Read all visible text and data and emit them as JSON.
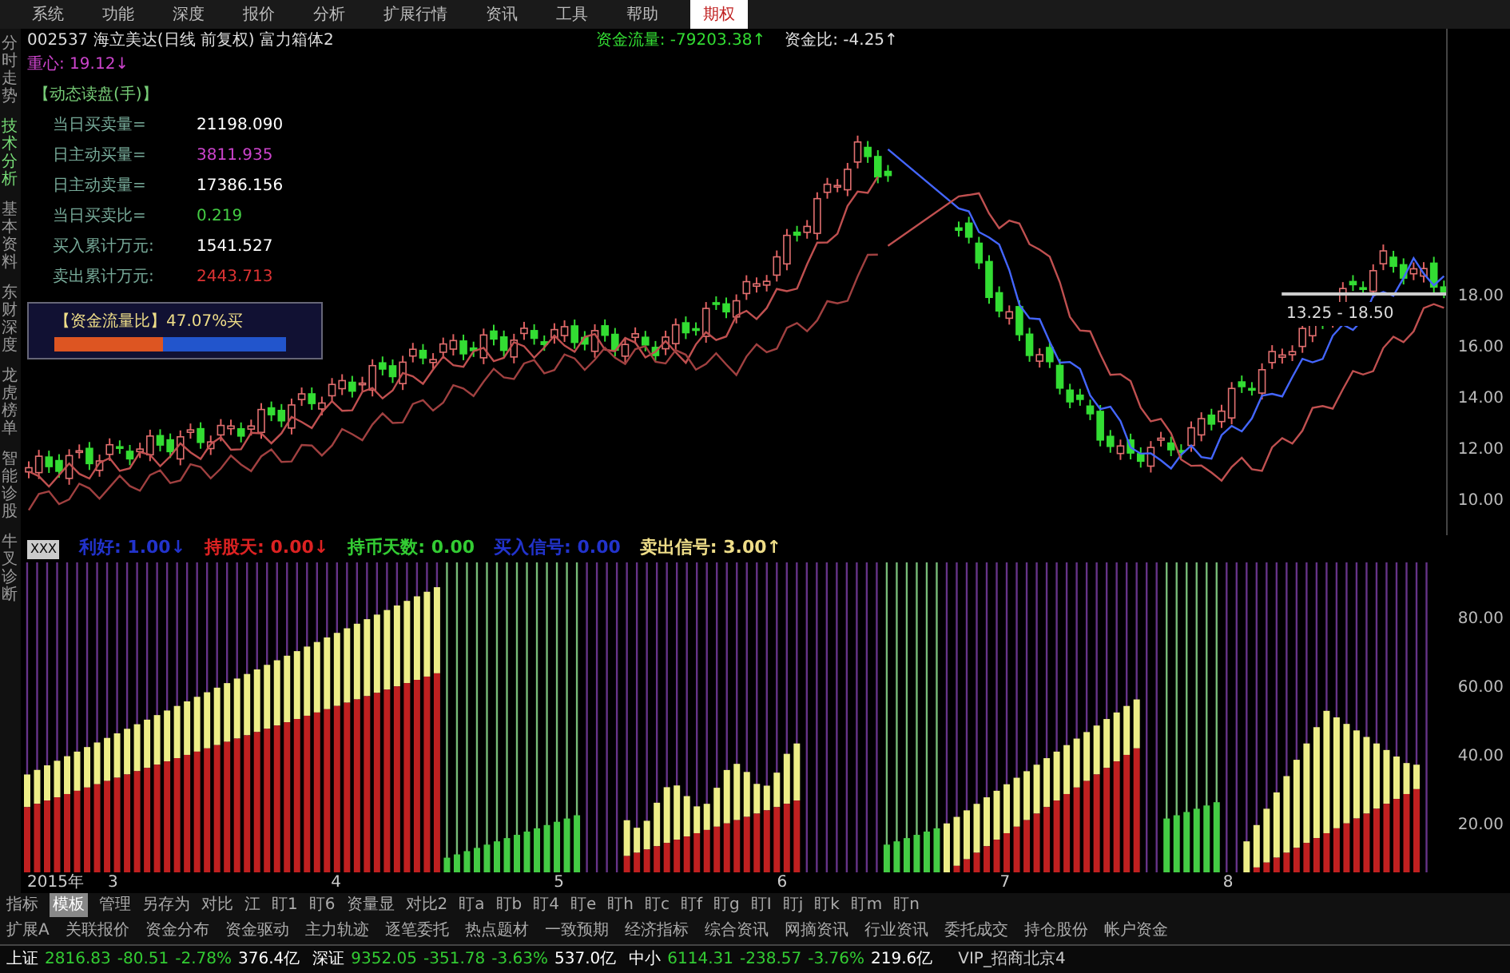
{
  "menu": [
    {
      "label": "系统",
      "selected": false
    },
    {
      "label": "功能",
      "selected": false
    },
    {
      "label": "深度",
      "selected": false
    },
    {
      "label": "报价",
      "selected": false
    },
    {
      "label": "分析",
      "selected": false
    },
    {
      "label": "扩展行情",
      "selected": false
    },
    {
      "label": "资讯",
      "selected": false
    },
    {
      "label": "工具",
      "selected": false
    },
    {
      "label": "帮助",
      "selected": false
    },
    {
      "label": "期权",
      "selected": true
    }
  ],
  "sidebar": [
    {
      "label": "分时走势",
      "selected": false
    },
    {
      "label": "技术分析",
      "selected": true
    },
    {
      "label": "基本资料",
      "selected": false
    },
    {
      "label": "东财深度",
      "selected": false
    },
    {
      "label": "龙虎榜单",
      "selected": false
    },
    {
      "label": "智能诊股",
      "selected": false
    },
    {
      "label": "牛叉诊断",
      "selected": false
    }
  ],
  "header": {
    "title": "002537 海立美达(日线 前复权) 富力箱体2",
    "readings": [
      {
        "text": "资金流量: -79203.38↑",
        "color": "#33dd33"
      },
      {
        "text": "资金比: -4.25↑",
        "color": "#e0e0e0"
      }
    ],
    "center": "重心: 19.12↓"
  },
  "info_panel": {
    "title": "【动态读盘(手)】",
    "rows": [
      {
        "label": "当日买卖量=",
        "value": "21198.090",
        "color": "#ffffff"
      },
      {
        "label": "日主动买量=",
        "value": "3811.935",
        "color": "#cc44cc"
      },
      {
        "label": "日主动卖量=",
        "value": "17386.156",
        "color": "#ffffff"
      },
      {
        "label": "当日买卖比=",
        "value": "0.219",
        "color": "#44cc44"
      },
      {
        "label": "买入累计万元:",
        "value": "1541.527",
        "color": "#ffffff"
      },
      {
        "label": "卖出累计万元:",
        "value": "2443.713",
        "color": "#dd3333"
      }
    ]
  },
  "fund_ratio": {
    "text": "【资金流量比】47.07%买",
    "level": 0.47
  },
  "price_axis": [
    "18.00",
    "16.00",
    "14.00",
    "12.00",
    "10.00"
  ],
  "range_label": "13.25 - 18.50",
  "indicator": {
    "name": "XXX",
    "items": [
      {
        "text": "利好: 1.00↓",
        "color": "#2233cc"
      },
      {
        "text": "持股天: 0.00↓",
        "color": "#dd2222"
      },
      {
        "text": "持币天数: 0.00",
        "color": "#33cc33"
      },
      {
        "text": "买入信号: 0.00",
        "color": "#2233cc"
      },
      {
        "text": "卖出信号: 3.00↑",
        "color": "#eedd88"
      }
    ]
  },
  "lower_axis": [
    "80.00",
    "60.00",
    "40.00",
    "20.00"
  ],
  "dates": [
    "2015年",
    "3",
    "4",
    "5",
    "6",
    "7",
    "8"
  ],
  "tabs": [
    {
      "label": "指标",
      "selected": false
    },
    {
      "label": "模板",
      "selected": true
    },
    {
      "label": "管理",
      "selected": false
    },
    {
      "label": "另存为",
      "selected": false
    },
    {
      "label": "对比",
      "selected": false
    },
    {
      "label": "江",
      "selected": false
    },
    {
      "label": "盯1",
      "selected": false
    },
    {
      "label": "盯6",
      "selected": false
    },
    {
      "label": "资量显",
      "selected": false
    },
    {
      "label": "对比2",
      "selected": false
    },
    {
      "label": "盯a",
      "selected": false
    },
    {
      "label": "盯b",
      "selected": false
    },
    {
      "label": "盯4",
      "selected": false
    },
    {
      "label": "盯e",
      "selected": false
    },
    {
      "label": "盯h",
      "selected": false
    },
    {
      "label": "盯c",
      "selected": false
    },
    {
      "label": "盯f",
      "selected": false
    },
    {
      "label": "盯g",
      "selected": false
    },
    {
      "label": "盯I",
      "selected": false
    },
    {
      "label": "盯j",
      "selected": false
    },
    {
      "label": "盯k",
      "selected": false
    },
    {
      "label": "盯m",
      "selected": false
    },
    {
      "label": "盯n",
      "selected": false
    }
  ],
  "function_bar": [
    "扩展A",
    "关联报价",
    "资金分布",
    "资金驱动",
    "主力轨迹",
    "逐笔委托",
    "热点题材",
    "一致预期",
    "经济指标",
    "综合资讯",
    "网摘资讯",
    "行业资讯",
    "委托成交",
    "持仓股份",
    "帐户资金"
  ],
  "status_bar": {
    "indices": [
      {
        "name": "上证",
        "price": "2816.83",
        "change": "-80.51",
        "pct": "-2.78%",
        "amount": "376.4亿"
      },
      {
        "name": "深证",
        "price": "9352.05",
        "change": "-351.78",
        "pct": "-3.63%",
        "amount": "537.0亿"
      },
      {
        "name": "中小",
        "price": "6114.31",
        "change": "-238.57",
        "pct": "-3.76%",
        "amount": "219.6亿"
      }
    ],
    "server": "VIP_招商北京4"
  }
}
